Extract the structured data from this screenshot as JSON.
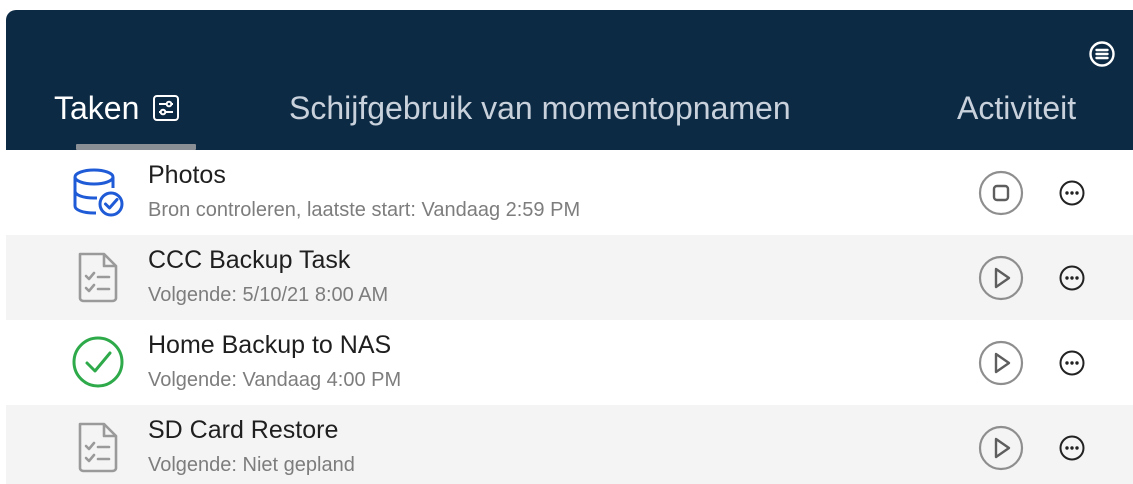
{
  "header": {
    "menu_icon": "list-circle-icon",
    "tabs": [
      {
        "label": "Taken",
        "icon": "settings-sliders-icon",
        "active": true
      },
      {
        "label": "Schijfgebruik van momentopnamen",
        "active": false
      },
      {
        "label": "Activiteit",
        "active": false
      }
    ]
  },
  "tasks": [
    {
      "title": "Photos",
      "subtitle": "Bron controleren, laatste start: Vandaag 2:59 PM",
      "icon": "database-check-icon",
      "action": "stop-icon"
    },
    {
      "title": "CCC Backup Task",
      "subtitle": "Volgende: 5/10/21 8:00 AM",
      "icon": "checklist-doc-icon",
      "action": "play-icon"
    },
    {
      "title": "Home Backup to NAS",
      "subtitle": "Volgende: Vandaag 4:00 PM",
      "icon": "success-check-icon",
      "action": "play-icon"
    },
    {
      "title": "SD Card Restore",
      "subtitle": "Volgende: Niet gepland",
      "icon": "checklist-doc-icon",
      "action": "play-icon"
    }
  ],
  "colors": {
    "header_bg": "#0d2a44",
    "accent_blue": "#1f5bd6",
    "success_green": "#2eaa4a",
    "icon_gray": "#9a9a9a"
  }
}
